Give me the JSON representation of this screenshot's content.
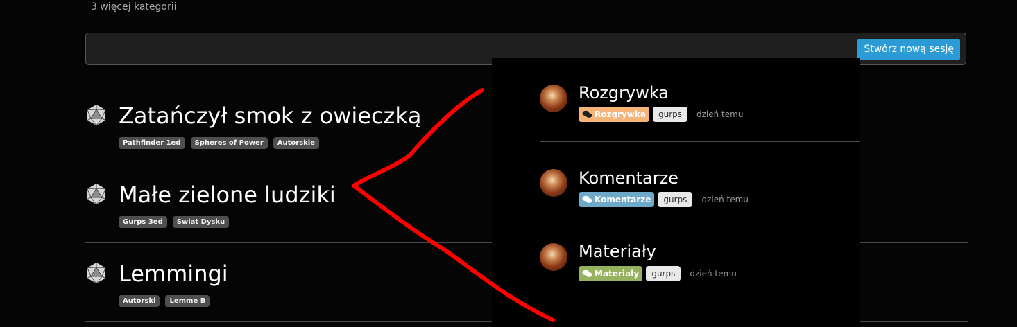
{
  "more_categories": "3 więcej kategorii",
  "toolbar": {
    "create_label": "Stwórz nową sesję"
  },
  "sessions": [
    {
      "title": "Zatańczył smok z owieczką",
      "tags": [
        "Pathfinder 1ed",
        "Spheres of Power",
        "Autorskie"
      ]
    },
    {
      "title": "Małe zielone ludziki",
      "tags": [
        "Gurps 3ed",
        "Świat Dysku"
      ]
    },
    {
      "title": "Lemmingi",
      "tags": [
        "Autorski",
        "Lemme B"
      ]
    }
  ],
  "categories": [
    {
      "name": "Rozgrywka",
      "badge": "Rozgrywka",
      "tag": "gurps",
      "time": "dzień temu",
      "color": "#f6b477"
    },
    {
      "name": "Komentarze",
      "badge": "Komentarze",
      "tag": "gurps",
      "time": "dzień temu",
      "color": "#6fa9c9"
    },
    {
      "name": "Materiały",
      "badge": "Materiały",
      "tag": "gurps",
      "time": "dzień temu",
      "color": "#97b25f"
    }
  ],
  "colors": {
    "accent_button": "#2b9bd6",
    "annotation_line": "#ff0000"
  },
  "icons": {
    "session": "d20-die-icon",
    "category_badge": "chat-bubbles-icon"
  }
}
